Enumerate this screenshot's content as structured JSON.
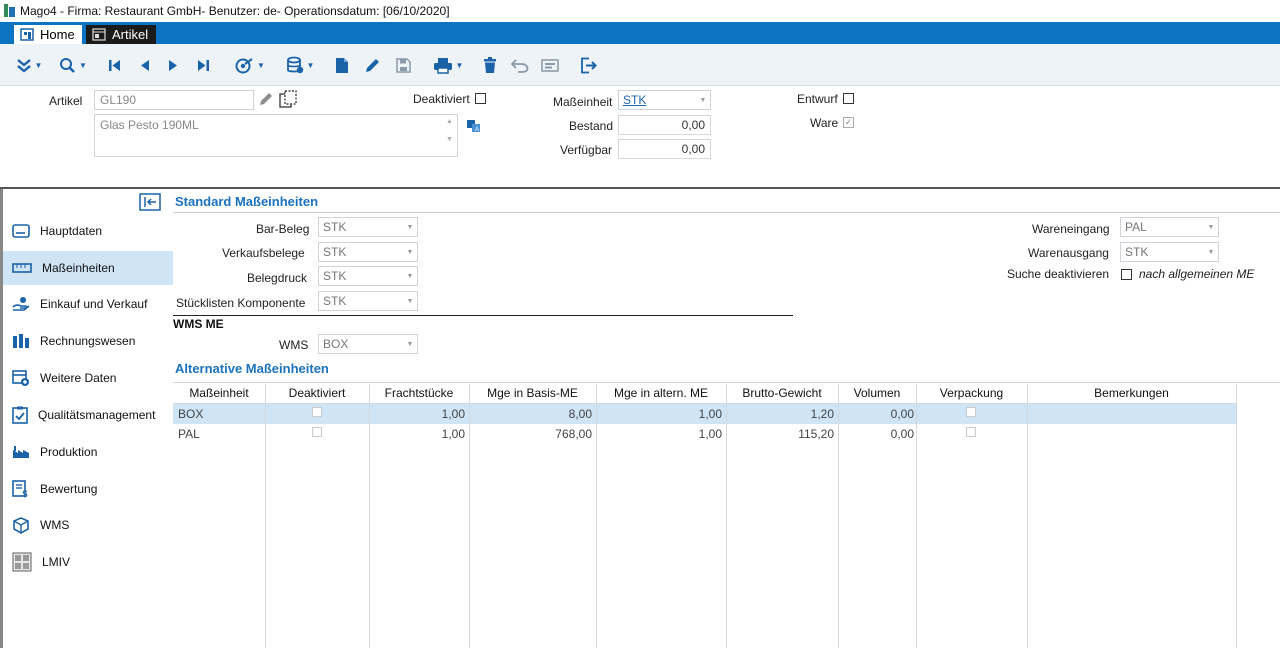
{
  "titlebar": {
    "text": "Mago4 - Firma: Restaurant GmbH- Benutzer: de- Operationsdatum: [06/10/2020]"
  },
  "tabs": [
    {
      "label": "Home"
    },
    {
      "label": "Artikel"
    }
  ],
  "colors": {
    "accent": "#0b74c2",
    "section": "#1b73bf",
    "selectedRow": "#cfe4f5",
    "toolbar": "#eef3f8"
  },
  "header": {
    "artikel_label": "Artikel",
    "artikel_value": "GL190",
    "description": "Glas Pesto 190ML",
    "deaktiviert_label": "Deaktiviert",
    "masseinheit_label": "Maßeinheit",
    "masseinheit_value": "STK",
    "bestand_label": "Bestand",
    "bestand_value": "0,00",
    "verfuegbar_label": "Verfügbar",
    "verfuegbar_value": "0,00",
    "entwurf_label": "Entwurf",
    "ware_label": "Ware"
  },
  "sidebar": {
    "items": [
      {
        "label": "Hauptdaten",
        "icon": "card-icon"
      },
      {
        "label": "Maßeinheiten",
        "icon": "ruler-icon"
      },
      {
        "label": "Einkauf und Verkauf",
        "icon": "hand-coin-icon"
      },
      {
        "label": "Rechnungswesen",
        "icon": "ledger-icon"
      },
      {
        "label": "Weitere Daten",
        "icon": "calendar-add-icon"
      },
      {
        "label": "Qualitätsmanagement",
        "icon": "clipboard-check-icon"
      },
      {
        "label": "Produktion",
        "icon": "factory-icon"
      },
      {
        "label": "Bewertung",
        "icon": "valuation-icon"
      },
      {
        "label": "WMS",
        "icon": "cubes-icon"
      },
      {
        "label": "LMIV",
        "icon": "grid-icon"
      }
    ]
  },
  "standard": {
    "title": "Standard Maßeinheiten",
    "bar_beleg_label": "Bar-Beleg",
    "bar_beleg_value": "STK",
    "verkaufsbelege_label": "Verkaufsbelege",
    "verkaufsbelege_value": "STK",
    "belegdruck_label": "Belegdruck",
    "belegdruck_value": "STK",
    "stueckliste_label": "Stücklisten Komponente",
    "stueckliste_value": "STK",
    "wareneingang_label": "Wareneingang",
    "wareneingang_value": "PAL",
    "warenausgang_label": "Warenausgang",
    "warenausgang_value": "STK",
    "suche_label": "Suche deaktivieren",
    "suche_option": "nach allgemeinen ME"
  },
  "wms": {
    "title": "WMS ME",
    "label": "WMS",
    "value": "BOX"
  },
  "alternative": {
    "title": "Alternative Maßeinheiten",
    "columns": [
      "Maßeinheit",
      "Deaktiviert",
      "Frachtstücke",
      "Mge in Basis-ME",
      "Mge in altern. ME",
      "Brutto-Gewicht",
      "Volumen",
      "Verpackung",
      "Bemerkungen"
    ],
    "rows": [
      {
        "me": "BOX",
        "fracht": "1,00",
        "basis": "8,00",
        "altern": "1,00",
        "brutto": "1,20",
        "volumen": "0,00"
      },
      {
        "me": "PAL",
        "fracht": "1,00",
        "basis": "768,00",
        "altern": "1,00",
        "brutto": "115,20",
        "volumen": "0,00"
      }
    ]
  }
}
